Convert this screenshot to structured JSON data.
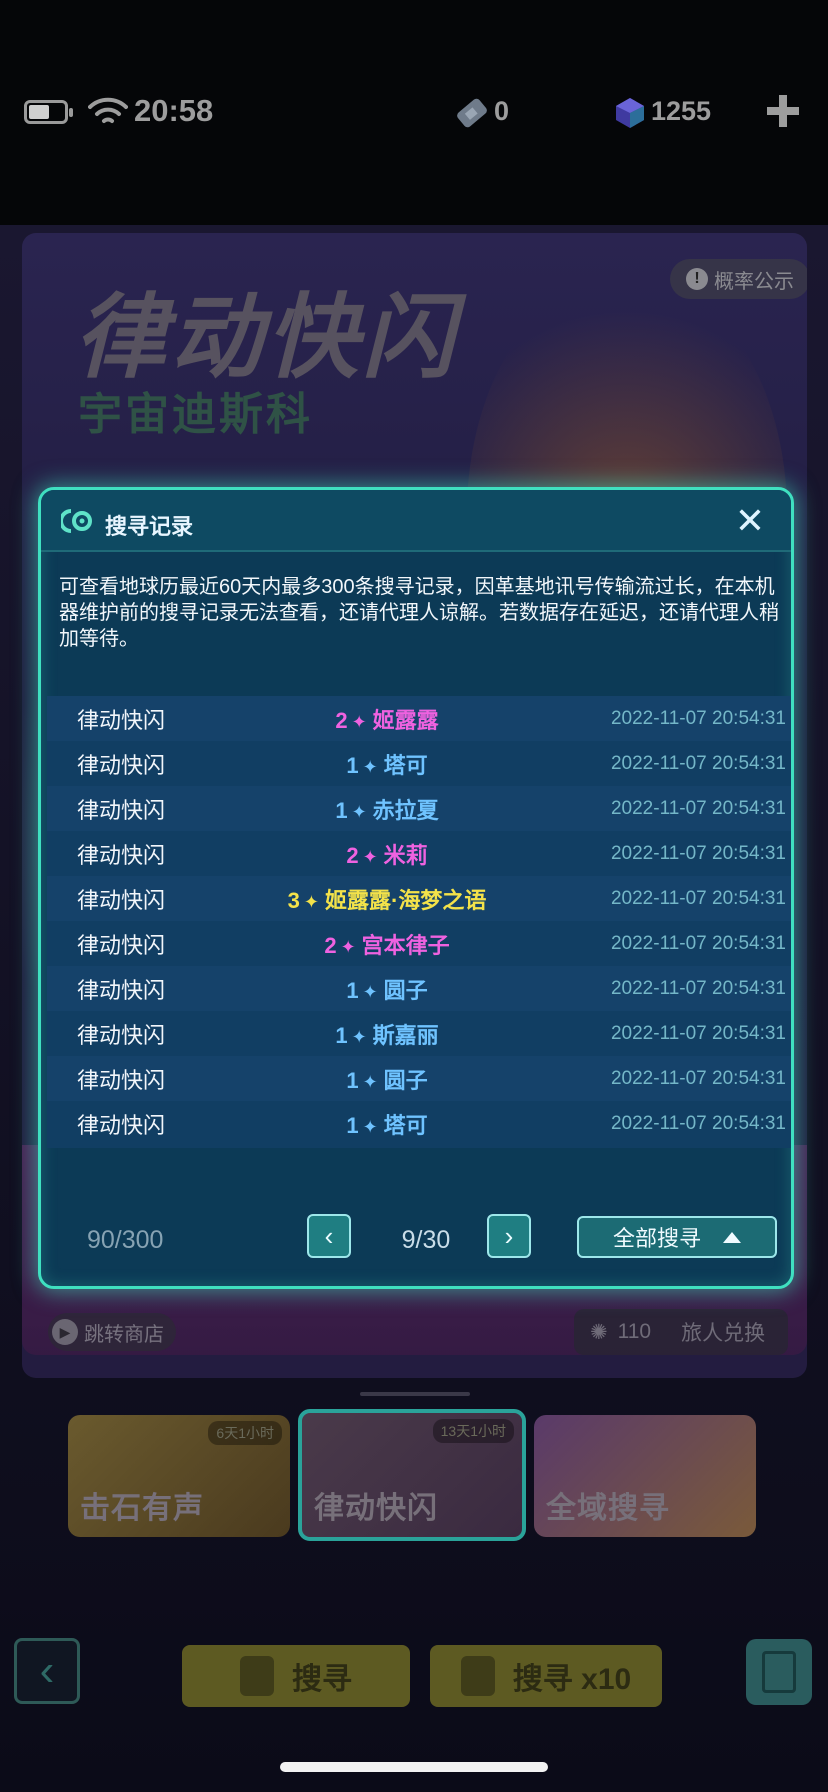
{
  "status_bar": {
    "time": "20:58",
    "battery_level": 0.55,
    "ticket_count": "0",
    "gem_count": "1255",
    "plus_label": "+"
  },
  "banner": {
    "title": "律动快闪",
    "subtitle": "宇宙迪斯科",
    "prob_button": "概率公示"
  },
  "modal": {
    "title": "搜寻记录",
    "close_icon": "close-icon",
    "description": "可查看地球历最近60天内最多300条搜寻记录，因革基地讯号传输流过长，在本机器维护前的搜寻记录无法查看，还请代理人谅解。若数据存在延迟，还请代理人稍加等待。",
    "records": [
      {
        "pool": "律动快闪",
        "rarity": "2",
        "name": "姬露露",
        "time": "2022-11-07 20:54:31",
        "color": "#ef62e0"
      },
      {
        "pool": "律动快闪",
        "rarity": "1",
        "name": "塔可",
        "time": "2022-11-07 20:54:31",
        "color": "#6fc3ff"
      },
      {
        "pool": "律动快闪",
        "rarity": "1",
        "name": "赤拉夏",
        "time": "2022-11-07 20:54:31",
        "color": "#6fc3ff"
      },
      {
        "pool": "律动快闪",
        "rarity": "2",
        "name": "米莉",
        "time": "2022-11-07 20:54:31",
        "color": "#ef62e0"
      },
      {
        "pool": "律动快闪",
        "rarity": "3",
        "name": "姬露露·海梦之语",
        "time": "2022-11-07 20:54:31",
        "color": "#f3e24a"
      },
      {
        "pool": "律动快闪",
        "rarity": "2",
        "name": "宫本律子",
        "time": "2022-11-07 20:54:31",
        "color": "#ef62e0"
      },
      {
        "pool": "律动快闪",
        "rarity": "1",
        "name": "圆子",
        "time": "2022-11-07 20:54:31",
        "color": "#6fc3ff"
      },
      {
        "pool": "律动快闪",
        "rarity": "1",
        "name": "斯嘉丽",
        "time": "2022-11-07 20:54:31",
        "color": "#6fc3ff"
      },
      {
        "pool": "律动快闪",
        "rarity": "1",
        "name": "圆子",
        "time": "2022-11-07 20:54:31",
        "color": "#6fc3ff"
      },
      {
        "pool": "律动快闪",
        "rarity": "1",
        "name": "塔可",
        "time": "2022-11-07 20:54:31",
        "color": "#6fc3ff"
      }
    ],
    "record_count": "90/300",
    "page_indicator": "9/30",
    "prev_label": "‹",
    "next_label": "›",
    "filter_label": "全部搜寻"
  },
  "background": {
    "shop_link": "跳转商店",
    "exchange_count": "110",
    "exchange_label": "旅人兑换",
    "pool_cards": [
      {
        "label": "击石有声",
        "timer": "6天1小时"
      },
      {
        "label": "律动快闪",
        "timer": "13天1小时"
      },
      {
        "label": "全域搜寻",
        "timer": ""
      }
    ],
    "back_label": "‹",
    "search_label": "搜寻",
    "search10_label": "搜寻 x10"
  }
}
